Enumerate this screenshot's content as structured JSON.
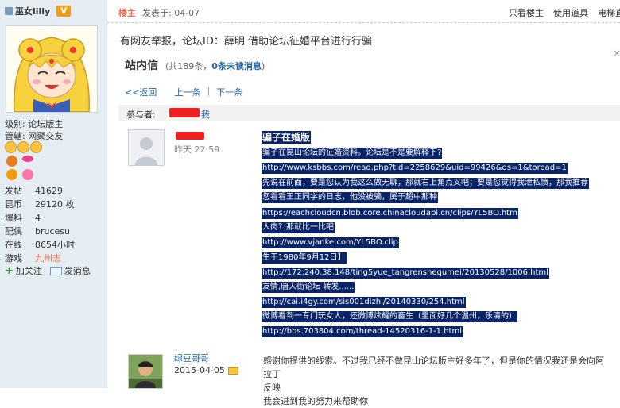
{
  "user": {
    "name": "巫女lilly",
    "badge": "V",
    "level_label": "级别: 论坛版主",
    "admin_label": "管辖: 网聚交友",
    "stats": [
      {
        "key": "发帖",
        "value": "41629"
      },
      {
        "key": "昆币",
        "value": "29120 枚"
      },
      {
        "key": "爆料",
        "value": "4"
      },
      {
        "key": "配偶",
        "value": "brucesu"
      },
      {
        "key": "在线",
        "value": "8654小时"
      },
      {
        "key": "游戏",
        "value": "九州志"
      }
    ],
    "follow_label": "加关注",
    "message_label": "发消息"
  },
  "post": {
    "floor": "楼主",
    "posted_at": "发表于: 04-07",
    "tools": [
      "只看楼主",
      "使用道具",
      "电梯直达"
    ],
    "report_text": "有网友举报，论坛ID：薛明 借助论坛征婚平台进行行骗"
  },
  "pm": {
    "title": "站内信",
    "count_prefix": "(共189条，",
    "unread": "0条未读消息",
    "count_suffix": ")",
    "close": "×",
    "back": "<<返回",
    "prev": "上一条",
    "next": "下一条",
    "separator": "|",
    "participants_label": "参与者:",
    "me": "我"
  },
  "message1": {
    "time": "昨天 22:59",
    "lines": [
      "骗子在婚版",
      "骗子在昆山论坛的征婚资料。论坛是不是要解释下?",
      "http://www.ksbbs.com/read.php?tid=2258629&uid=99426&ds=1&toread=1",
      "先说在前面，要是您认为我这么做无聊，那就右上角点叉吧；要是您觉得我泄私愤，那我推荐",
      "您看看王正同学的日志，他没被骗，属于超中那种",
      "https://eachcloudcn.blob.core.chinacloudapi.cn/clips/YL5BO.htm",
      "人肉？那就比一比吧",
      "http://www.vjanke.com/YL5BO.clip",
      "生于1980年9月12日】",
      "http://172.240.38.148/ting5yue_tangrenshequmei/20130528/1006.html",
      "友情,唐人街论坛 转发......",
      "http://cai.i4gy.com/sis001dizhi/20140330/254.html",
      "微博看到一专门玩女人，还微博炫耀的畜生（里面好几个温州，乐清的）",
      "http://bbs.703804.com/thread-14520316-1-1.html"
    ]
  },
  "message2": {
    "name": "绿豆哥哥",
    "date": "2015-04-05",
    "text_line1": "感谢你提供的线索。不过我已经不做昆山论坛版主好多年了，但是你的情况我还是会向阿拉丁",
    "text_line2": "反映",
    "text_line3": "我会进到我的努力来帮助你"
  },
  "colors": {
    "sidebar_bg": "#e5edf2",
    "link": "#2366a8",
    "accent": "#f26c4f",
    "highlight": "#0a246a"
  }
}
